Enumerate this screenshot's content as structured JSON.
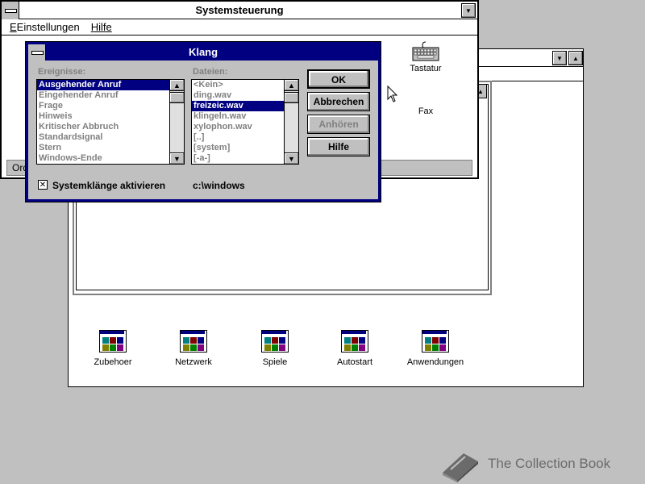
{
  "progman": {
    "groups": [
      {
        "label": "Zubehoer"
      },
      {
        "label": "Netzwerk"
      },
      {
        "label": "Spiele"
      },
      {
        "label": "Autostart"
      },
      {
        "label": "Anwendungen"
      }
    ]
  },
  "control_panel": {
    "title": "Systemsteuerung",
    "menu": {
      "settings": "Einstellungen",
      "help": "Hilfe"
    },
    "icons": {
      "keyboard": "Tastatur",
      "fax": "Fax"
    },
    "status_text": "Ord"
  },
  "klang": {
    "title": "Klang",
    "events_label": "Ereignisse:",
    "files_label": "Dateien:",
    "events": [
      "Ausgehender Anruf",
      "Eingehender Anruf",
      "Frage",
      "Hinweis",
      "Kritischer Abbruch",
      "Standardsignal",
      "Stern",
      "Windows-Ende"
    ],
    "selected_event": "Ausgehender Anruf",
    "files": [
      "<Kein>",
      "ding.wav",
      "freizeic.wav",
      "klingeln.wav",
      "xylophon.wav",
      "[..]",
      "[system]",
      "[-a-]"
    ],
    "selected_file": "freizeic.wav",
    "buttons": {
      "ok": "OK",
      "cancel": "Abbrechen",
      "listen": "Anhören",
      "help": "Hilfe"
    },
    "enable_sounds_label": "Systemklänge aktivieren",
    "enable_sounds_checked": true,
    "path": "c:\\windows"
  },
  "watermark": "The Collection Book"
}
